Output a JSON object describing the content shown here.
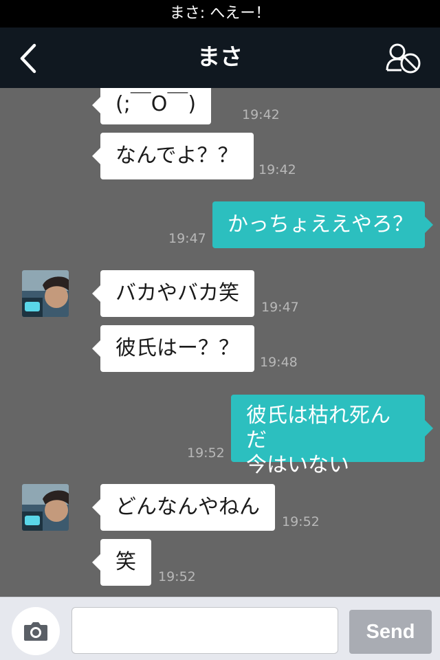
{
  "status_bar": {
    "notification": "まさ: へえー！"
  },
  "header": {
    "title": "まさ",
    "back_icon": "chevron-left-icon",
    "action_icon": "block-user-icon"
  },
  "messages": [
    {
      "direction": "in",
      "text": "(;￣O￣)",
      "time": "19:42"
    },
    {
      "direction": "in",
      "text": "なんでよ？？",
      "time": "19:42"
    },
    {
      "direction": "out",
      "text": "かっちょええやろ？",
      "time": "19:47"
    },
    {
      "direction": "in",
      "text": "バカやバカ笑",
      "time": "19:47",
      "avatar": true
    },
    {
      "direction": "in",
      "text": "彼氏はー？？",
      "time": "19:48"
    },
    {
      "direction": "out",
      "lines": [
        "彼氏は枯れ死んだ",
        "今はいない"
      ],
      "time": "19:52"
    },
    {
      "direction": "in",
      "text": "どんなんやねん",
      "time": "19:52",
      "avatar": true
    },
    {
      "direction": "in",
      "text": "笑",
      "time": "19:52"
    }
  ],
  "input_bar": {
    "camera_icon": "camera-icon",
    "placeholder": "",
    "send_label": "Send"
  },
  "colors": {
    "background": "#666666",
    "header": "#101820",
    "outgoing_bubble": "#2cbfbf",
    "incoming_bubble": "#ffffff",
    "send_button": "#a9acb3"
  }
}
